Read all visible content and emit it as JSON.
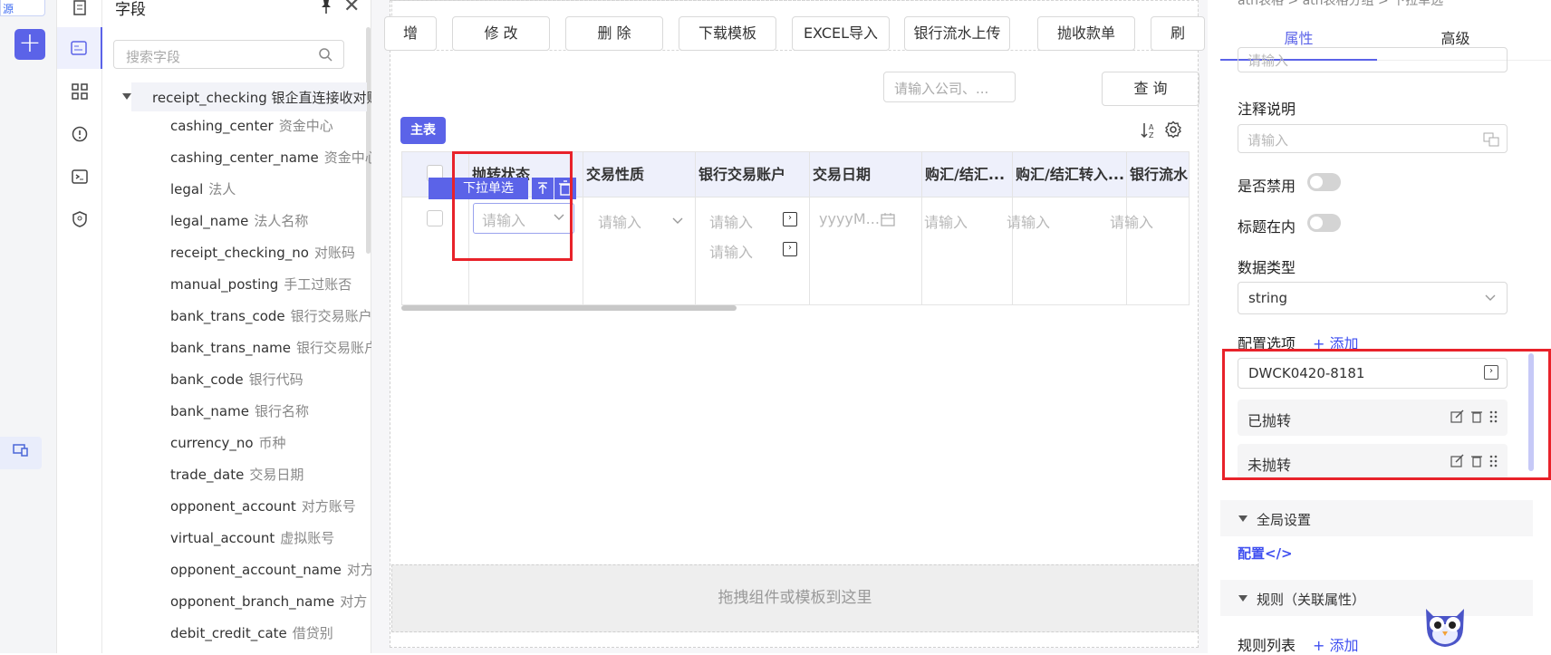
{
  "left_strip": {
    "top_label": "源"
  },
  "fields_panel": {
    "title": "字段",
    "search_placeholder": "搜索字段",
    "root": "receipt_checking 银企直连接收对账",
    "fields": [
      {
        "name": "cashing_center",
        "cn": "资金中心"
      },
      {
        "name": "cashing_center_name",
        "cn": "资金中心"
      },
      {
        "name": "legal",
        "cn": "法人"
      },
      {
        "name": "legal_name",
        "cn": "法人名称"
      },
      {
        "name": "receipt_checking_no",
        "cn": "对账码"
      },
      {
        "name": "manual_posting",
        "cn": "手工过账否"
      },
      {
        "name": "bank_trans_code",
        "cn": "银行交易账户"
      },
      {
        "name": "bank_trans_name",
        "cn": "银行交易账户"
      },
      {
        "name": "bank_code",
        "cn": "银行代码"
      },
      {
        "name": "bank_name",
        "cn": "银行名称"
      },
      {
        "name": "currency_no",
        "cn": "币种"
      },
      {
        "name": "trade_date",
        "cn": "交易日期"
      },
      {
        "name": "opponent_account",
        "cn": "对方账号"
      },
      {
        "name": "virtual_account",
        "cn": "虚拟账号"
      },
      {
        "name": "opponent_account_name",
        "cn": "对方"
      },
      {
        "name": "opponent_branch_name",
        "cn": "对方"
      },
      {
        "name": "debit_credit_cate",
        "cn": "借贷别"
      }
    ]
  },
  "toolbar": {
    "buttons": [
      "增",
      "修 改",
      "删 除",
      "下载模板",
      "EXCEL导入",
      "银行流水上传",
      "抛收款单",
      "刷"
    ]
  },
  "query": {
    "placeholder": "请输入公司、...",
    "button": "查 询"
  },
  "main_tag": "主表",
  "table": {
    "columns": [
      "抛转状态",
      "交易性质",
      "银行交易账户",
      "交易日期",
      "购汇/结汇...",
      "购汇/结汇转入...",
      "银行流水"
    ],
    "placeholder": "请输入",
    "date_placeholder": "yyyyM...",
    "selected_label": "下拉单选"
  },
  "drop_zone": "拖拽组件或模板到这里",
  "right_panel": {
    "breadcrumb": "ath表格 > ath表格分组 > 下拉单选",
    "tabs": [
      "属性",
      "高级"
    ],
    "top_input_placeholder": "请输入",
    "note_label": "注释说明",
    "note_placeholder": "请输入",
    "disabled_label": "是否禁用",
    "title_inside_label": "标题在内",
    "data_type_label": "数据类型",
    "data_type_value": "string",
    "options_label": "配置选项",
    "add_label": "+ 添加",
    "option_input": "DWCK0420-8181",
    "options": [
      "已抛转",
      "未抛转"
    ],
    "global_settings": "全局设置",
    "config_link": "配置</>",
    "rules_section": "规则（关联属性）",
    "rules_list_label": "规则列表",
    "rules_add": "+ 添加"
  }
}
